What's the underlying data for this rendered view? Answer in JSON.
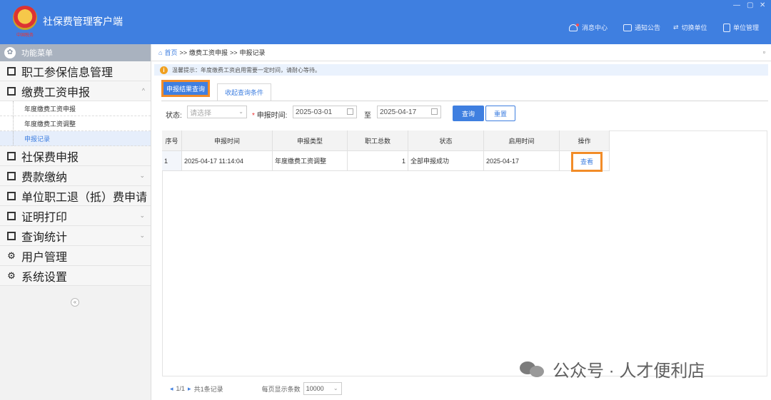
{
  "app": {
    "title": "社保费管理客户端",
    "logo_text": "中国税务"
  },
  "window": {
    "minimize": "—",
    "maximize": "▢",
    "close": "✕"
  },
  "header": {
    "items": [
      {
        "label": "消息中心",
        "icon": "bell-icon"
      },
      {
        "label": "通知公告",
        "icon": "mail-icon"
      },
      {
        "label": "切换单位",
        "icon": "switch-icon"
      },
      {
        "label": "单位管理",
        "icon": "building-icon"
      }
    ]
  },
  "sidebar": {
    "title": "功能菜单",
    "items": [
      {
        "label": "职工参保信息管理",
        "icon": "list-icon",
        "chevron": ""
      },
      {
        "label": "缴费工资申报",
        "icon": "edit-icon",
        "chevron": "^"
      },
      {
        "label": "社保费申报",
        "icon": "list-icon",
        "chevron": ""
      },
      {
        "label": "费款缴纳",
        "icon": "list-icon",
        "chevron": "⌄"
      },
      {
        "label": "单位职工退（抵）费申请",
        "icon": "list-icon",
        "chevron": ""
      },
      {
        "label": "证明打印",
        "icon": "print-icon",
        "chevron": "⌄"
      },
      {
        "label": "查询统计",
        "icon": "chart-icon",
        "chevron": "⌄"
      },
      {
        "label": "用户管理",
        "icon": "gear-icon",
        "chevron": ""
      },
      {
        "label": "系统设置",
        "icon": "gear-icon",
        "chevron": ""
      }
    ],
    "subitems": [
      "年度缴费工资申报",
      "年度缴费工资调整",
      "申报记录"
    ],
    "collapse": "«"
  },
  "breadcrumb": {
    "home": "首页",
    "sep": ">>",
    "level1": "缴费工资申报",
    "level2": "申报记录",
    "close": "▫"
  },
  "tip": {
    "icon": "i",
    "text": "温馨提示：年度缴费工资启用需要一定时间，请耐心等待。"
  },
  "tabs": {
    "active": "申报结果查询",
    "inactive": "收起查询条件"
  },
  "filter": {
    "status_label": "状态:",
    "status_placeholder": "请选择",
    "required_mark": "*",
    "date_label": "申报时间:",
    "date_from": "2025-03-01",
    "date_to_label": "至",
    "date_to": "2025-04-17",
    "query_button": "查询",
    "reset_button": "重置"
  },
  "table": {
    "headers": [
      "序号",
      "申报时间",
      "申报类型",
      "职工总数",
      "状态",
      "启用时间",
      "操作"
    ],
    "rows": [
      {
        "no": "1",
        "time": "2025-04-17 11:14:04",
        "type": "年度缴费工资调整",
        "count": "1",
        "status": "全部申报成功",
        "effective": "2025-04-17",
        "action": "查看"
      }
    ]
  },
  "pager": {
    "pages": "1/1",
    "total": "共1条记录",
    "size_label": "每页显示条数",
    "size": "10000"
  },
  "watermark": {
    "text": "公众号 · 人才便利店"
  },
  "colors": {
    "primary": "#3f7fe0",
    "highlight": "#f28c28",
    "sidebar_head": "#a9b2bf"
  }
}
